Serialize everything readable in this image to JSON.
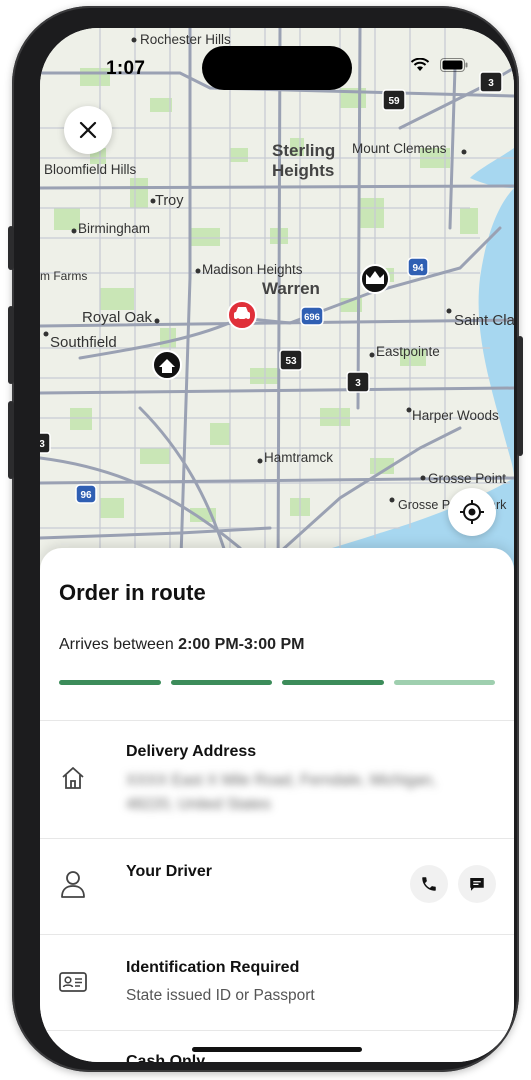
{
  "status_bar": {
    "time": "1:07"
  },
  "map": {
    "labels": {
      "rochester_hills": "Rochester Hills",
      "bloomfield_hills": "Bloomfield Hills",
      "troy": "Troy",
      "sterling_heights_1": "Sterling",
      "sterling_heights_2": "Heights",
      "mount_clemens": "Mount Clemens",
      "birmingham": "Birmingham",
      "farms": "m Farms",
      "madison_heights": "Madison Heights",
      "warren": "Warren",
      "royal_oak": "Royal Oak",
      "southfield": "Southfield",
      "saint_clair": "Saint Cla",
      "eastpointe": "Eastpointe",
      "harper_woods": "Harper Woods",
      "hamtramck": "Hamtramck",
      "grosse_pointe": "Grosse Point",
      "grosse_pointe_park": "Grosse Pointe Park"
    },
    "shields": {
      "i696": "696",
      "i94": "94",
      "i96": "96",
      "m53": "53",
      "m59": "59",
      "m3a": "3",
      "m3b": "3",
      "m3c": "3"
    },
    "colors": {
      "land": "#eef0e8",
      "park": "#c9e6b6",
      "water": "#a7d7f0",
      "road": "#b3b8c7",
      "highway": "#8f96aa",
      "car_pin": "#e0303a"
    }
  },
  "order": {
    "title": "Order in route",
    "eta_prefix": "Arrives between ",
    "eta_window": "2:00 PM-3:00 PM",
    "progress": {
      "segments": 4,
      "completed": 3,
      "active_color": "#3c8c5a",
      "pending_color": "#9fcfaf"
    }
  },
  "delivery": {
    "label": "Delivery Address",
    "address": "XXXX East X Mile Road, Ferndale, Michigan, 48220, United States"
  },
  "driver": {
    "label": "Your Driver"
  },
  "identification": {
    "label": "Identification Required",
    "detail": "State issued ID or Passport"
  },
  "payment": {
    "label": "Cash Only"
  }
}
